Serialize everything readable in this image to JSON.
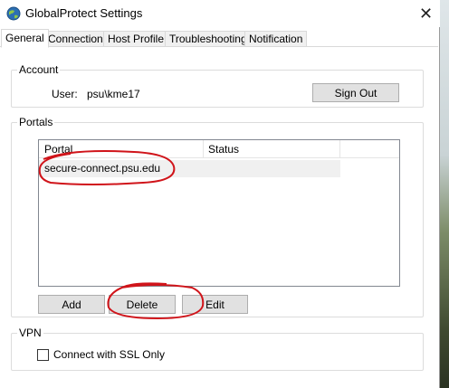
{
  "window": {
    "title": "GlobalProtect Settings",
    "close_glyph": "✕"
  },
  "tabs": [
    {
      "label": "General",
      "active": true
    },
    {
      "label": "Connection",
      "active": false
    },
    {
      "label": "Host Profile",
      "active": false
    },
    {
      "label": "Troubleshooting",
      "active": false
    },
    {
      "label": "Notification",
      "active": false
    }
  ],
  "account": {
    "legend": "Account",
    "user_label": "User:",
    "user_value": "psu\\kme17",
    "sign_out_label": "Sign Out"
  },
  "portals": {
    "legend": "Portals",
    "columns": [
      "Portal",
      "Status"
    ],
    "rows": [
      {
        "portal": "secure-connect.psu.edu",
        "status": ""
      }
    ],
    "add_label": "Add",
    "delete_label": "Delete",
    "edit_label": "Edit"
  },
  "vpn": {
    "legend": "VPN",
    "ssl_only_label": "Connect with SSL Only",
    "ssl_only_checked": false
  },
  "annotation_color": "#d0141a",
  "icons": {
    "app": "globe-icon",
    "close": "close-icon"
  }
}
